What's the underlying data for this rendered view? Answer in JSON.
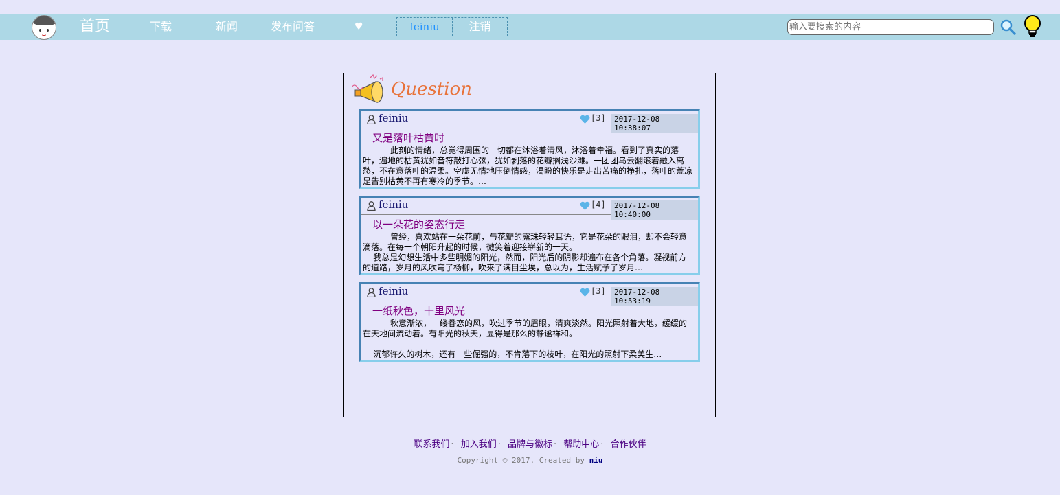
{
  "nav": {
    "home": "首页",
    "download": "下载",
    "news": "新闻",
    "publish": "发布问答",
    "heart": "♥",
    "username": "feiniu",
    "logout": "注销",
    "search_placeholder": "输入要搜索的内容"
  },
  "main": {
    "heading": "Question",
    "cards": [
      {
        "author": "feiniu",
        "likes": "[3]",
        "date": "2017-12-08 10:38:07",
        "title": "又是落叶枯黄时",
        "body": "此刻的情绪，总觉得周围的一切都在沐浴着清风，沐浴着幸福。看到了真实的落叶，遍地的枯黄犹如音符敲打心弦，犹如剥落的花瓣搁浅沙滩。一团团乌云翻滚着融入离愁，不在意落叶的温柔。空虚无情地压倒情感，渴盼的快乐是走出苦痛的挣扎，落叶的荒凉是告别枯黄不再有寒冷的季节。…"
      },
      {
        "author": "feiniu",
        "likes": "[4]",
        "date": "2017-12-08 10:40:00",
        "title": "以一朵花的姿态行走",
        "body": "曾经，喜欢站在一朵花前，与花瓣的露珠轻轻耳语，它是花朵的眼泪，却不会轻意滴落。在每一个朝阳升起的时候，微笑着迎接崭新的一天。\n    我总是幻想生活中多些明媚的阳光，然而，阳光后的阴影却遍布在各个角落。凝视前方的道路，岁月的风吹弯了杨柳，吹来了满目尘埃，总以为，生活赋予了岁月…"
      },
      {
        "author": "feiniu",
        "likes": "[3]",
        "date": "2017-12-08 10:53:19",
        "title": "一纸秋色，十里风光",
        "body": "秋意渐浓，一缕眷恋的风，吹过季节的眉眼，清爽淡然。阳光照射着大地，缓缓的在天地间流动着。有阳光的秋天，显得是那么的静谧祥和。\n\n    沉郁许久的树木，还有一些倔强的，不肯落下的枝叶，在阳光的照射下柔美生…"
      }
    ]
  },
  "footer": {
    "links": [
      "联系我们",
      "加入我们",
      "品牌与徽标",
      "帮助中心",
      "合作伙伴"
    ],
    "copyright_prefix": "Copyright © 2017. Created by",
    "copyright_author": "niu"
  },
  "colors": {
    "page_bg": "#e6e6fa",
    "nav_bg": "#add8e6",
    "heading": "#e8733a",
    "card_title": "#800080"
  }
}
